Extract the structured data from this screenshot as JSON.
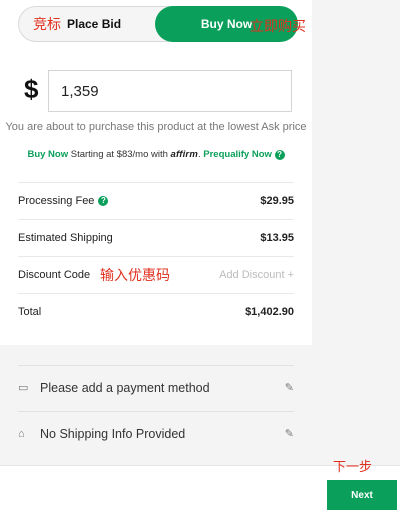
{
  "toggle": {
    "place_bid_cn": "竞标",
    "place_bid": "Place Bid",
    "buy_now": "Buy Now",
    "buy_now_cn": "立即购买"
  },
  "price": {
    "currency_symbol": "$",
    "value": "1,359"
  },
  "ask_note": "You are about to purchase this product at the lowest Ask price",
  "affirm": {
    "buy_now": "Buy Now",
    "starting": "Starting at $83/mo with",
    "logo": "affirm",
    "prequalify": "Prequalify Now"
  },
  "fees": {
    "processing_label": "Processing Fee",
    "processing_value": "$29.95",
    "shipping_label": "Estimated Shipping",
    "shipping_value": "$13.95",
    "discount_label": "Discount Code",
    "discount_cn": "输入优惠码",
    "discount_action": "Add Discount +",
    "total_label": "Total",
    "total_value": "$1,402.90"
  },
  "payment": {
    "payment_text": "Please add a payment method",
    "shipping_text": "No Shipping Info Provided"
  },
  "footer": {
    "next_cn": "下一步",
    "next_label": "Next"
  },
  "colors": {
    "accent": "#0a9f5a",
    "annotation": "#e0301e"
  },
  "icons": [
    "help-icon",
    "card-icon",
    "home-icon",
    "pencil-icon"
  ]
}
